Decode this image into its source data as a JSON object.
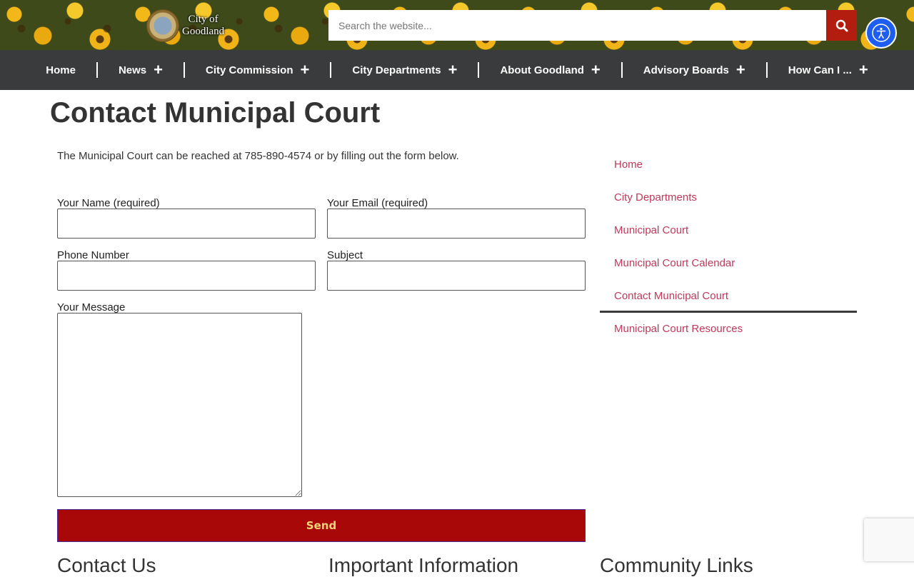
{
  "header": {
    "logo_line1": "City of",
    "logo_line2": "Goodland",
    "search_placeholder": "Search the website..."
  },
  "nav": {
    "items": [
      {
        "label": "Home",
        "has_submenu": false
      },
      {
        "label": "News",
        "has_submenu": true
      },
      {
        "label": "City Commission",
        "has_submenu": true
      },
      {
        "label": "City Departments",
        "has_submenu": true
      },
      {
        "label": "About Goodland",
        "has_submenu": true
      },
      {
        "label": "Advisory Boards",
        "has_submenu": true
      },
      {
        "label": "How Can I ...",
        "has_submenu": true
      }
    ],
    "plus": "+"
  },
  "page": {
    "title": "Contact Municipal Court",
    "intro": "The Municipal Court can be reached at 785-890-4574 or by filling out the form below."
  },
  "form": {
    "name_label": "Your Name (required)",
    "email_label": "Your Email (required)",
    "phone_label": "Phone Number",
    "subject_label": "Subject",
    "message_label": "Your Message",
    "send_label": "Send"
  },
  "sidebar": {
    "items": [
      {
        "label": "Home"
      },
      {
        "label": "City Departments"
      },
      {
        "label": "Municipal Court"
      },
      {
        "label": "Municipal Court Calendar"
      },
      {
        "label": "Contact Municipal Court",
        "active": true
      },
      {
        "label": "Municipal Court Resources"
      }
    ]
  },
  "footer": {
    "col1": "Contact Us",
    "col2": "Important Information",
    "col3": "Community Links"
  },
  "colors": {
    "nav_bg": "#3a3b3c",
    "send_bg": "#a80808",
    "search_btn": "#b31d0f",
    "link": "#c0395a",
    "a11y": "#1d5ef0"
  }
}
